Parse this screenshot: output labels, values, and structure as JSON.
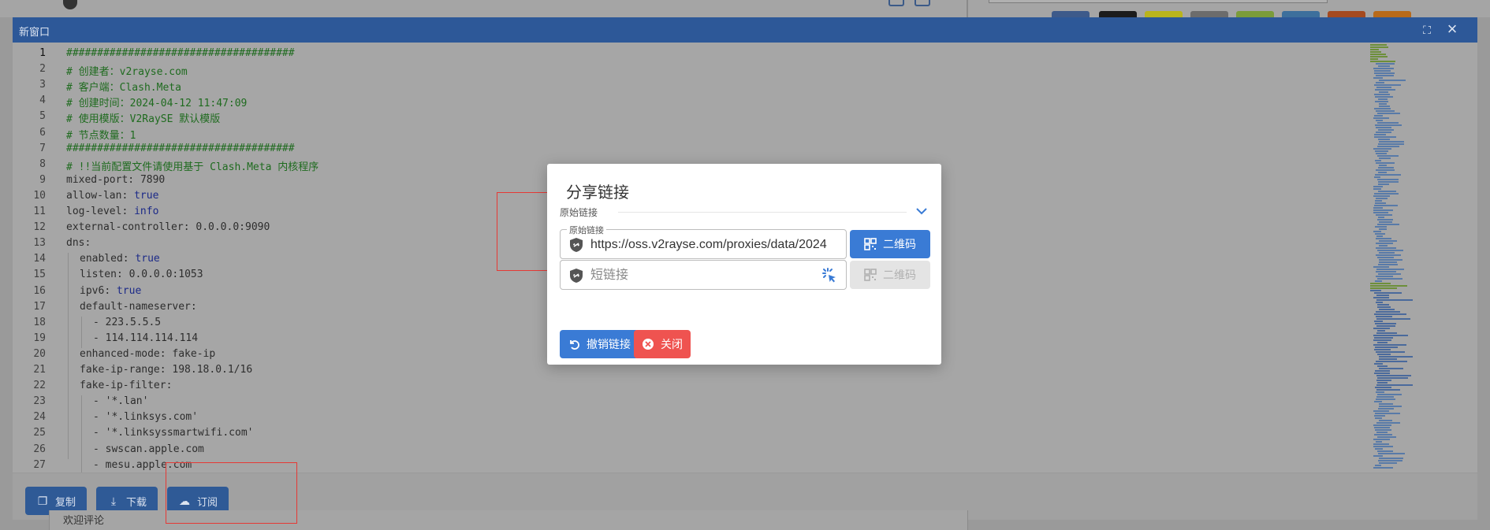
{
  "window": {
    "title": "新窗口",
    "maximize_icon": "maximize-icon",
    "close_icon": "close-icon"
  },
  "editor": {
    "line_numbers": [
      "1",
      "2",
      "3",
      "4",
      "5",
      "6",
      "7",
      "8",
      "9",
      "10",
      "11",
      "12",
      "13",
      "14",
      "15",
      "16",
      "17",
      "18",
      "19",
      "20",
      "21",
      "22",
      "23",
      "24",
      "25",
      "26",
      "27"
    ],
    "lines": [
      {
        "key": "",
        "sep": "",
        "val": "#####################################",
        "kind": "comment",
        "indent": 0
      },
      {
        "key": "",
        "sep": "",
        "val": "# 创建者：v2rayse.com",
        "kind": "comment",
        "indent": 0
      },
      {
        "key": "",
        "sep": "",
        "val": "# 客户端：Clash.Meta",
        "kind": "comment",
        "indent": 0
      },
      {
        "key": "",
        "sep": "",
        "val": "# 创建时间：2024-04-12 11:47:09",
        "kind": "comment",
        "indent": 0
      },
      {
        "key": "",
        "sep": "",
        "val": "# 使用模版：V2RaySE 默认模版",
        "kind": "comment",
        "indent": 0
      },
      {
        "key": "",
        "sep": "",
        "val": "# 节点数量：1",
        "kind": "comment",
        "indent": 0
      },
      {
        "key": "",
        "sep": "",
        "val": "#####################################",
        "kind": "comment",
        "indent": 0
      },
      {
        "key": "",
        "sep": "",
        "val": "# !!当前配置文件请使用基于 Clash.Meta 内核程序",
        "kind": "comment",
        "indent": 0
      },
      {
        "key": "mixed-port",
        "sep": ": ",
        "val": "7890",
        "kind": "plain",
        "indent": 0
      },
      {
        "key": "allow-lan",
        "sep": ": ",
        "val": "true",
        "kind": "keyword",
        "indent": 0
      },
      {
        "key": "log-level",
        "sep": ": ",
        "val": "info",
        "kind": "keyword",
        "indent": 0
      },
      {
        "key": "external-controller",
        "sep": ": ",
        "val": "0.0.0.0:9090",
        "kind": "plain",
        "indent": 0
      },
      {
        "key": "dns",
        "sep": ":",
        "val": "",
        "kind": "plain",
        "indent": 0
      },
      {
        "key": "enabled",
        "sep": ": ",
        "val": "true",
        "kind": "keyword",
        "indent": 1
      },
      {
        "key": "listen",
        "sep": ": ",
        "val": "0.0.0.0:1053",
        "kind": "plain",
        "indent": 1
      },
      {
        "key": "ipv6",
        "sep": ": ",
        "val": "true",
        "kind": "keyword",
        "indent": 1
      },
      {
        "key": "default-nameserver",
        "sep": ":",
        "val": "",
        "kind": "plain",
        "indent": 1
      },
      {
        "key": "",
        "sep": "",
        "val": "- 223.5.5.5",
        "kind": "plain",
        "indent": 2
      },
      {
        "key": "",
        "sep": "",
        "val": "- 114.114.114.114",
        "kind": "plain",
        "indent": 2
      },
      {
        "key": "enhanced-mode",
        "sep": ": ",
        "val": "fake-ip",
        "kind": "plain",
        "indent": 1
      },
      {
        "key": "fake-ip-range",
        "sep": ": ",
        "val": "198.18.0.1/16",
        "kind": "plain",
        "indent": 1
      },
      {
        "key": "fake-ip-filter",
        "sep": ":",
        "val": "",
        "kind": "plain",
        "indent": 1
      },
      {
        "key": "",
        "sep": "",
        "val": "- '*.lan'",
        "kind": "plain",
        "indent": 2
      },
      {
        "key": "",
        "sep": "",
        "val": "- '*.linksys.com'",
        "kind": "plain",
        "indent": 2
      },
      {
        "key": "",
        "sep": "",
        "val": "- '*.linksyssmartwifi.com'",
        "kind": "plain",
        "indent": 2
      },
      {
        "key": "",
        "sep": "",
        "val": "- swscan.apple.com",
        "kind": "plain",
        "indent": 2
      },
      {
        "key": "",
        "sep": "",
        "val": "- mesu.apple.com",
        "kind": "plain",
        "indent": 2
      }
    ]
  },
  "footer": {
    "copy_label": "复制",
    "download_label": "下载",
    "subscribe_label": "订阅"
  },
  "page": {
    "comments_label": "欢迎评论"
  },
  "dialog": {
    "title": "分享链接",
    "section_label": "原始链接",
    "original_field": {
      "legend": "原始链接",
      "value": "https://oss.v2rayse.com/proxies/data/2024"
    },
    "short_field": {
      "placeholder": "短链接"
    },
    "qr_label": "二维码",
    "qr_label_disabled": "二维码",
    "revoke_label": "撤销链接",
    "close_label": "关闭"
  },
  "colors": {
    "primary": "#3a7bd5",
    "danger": "#ef5350",
    "highlight_box": "#e53935",
    "titlebar": "#2d5898"
  }
}
